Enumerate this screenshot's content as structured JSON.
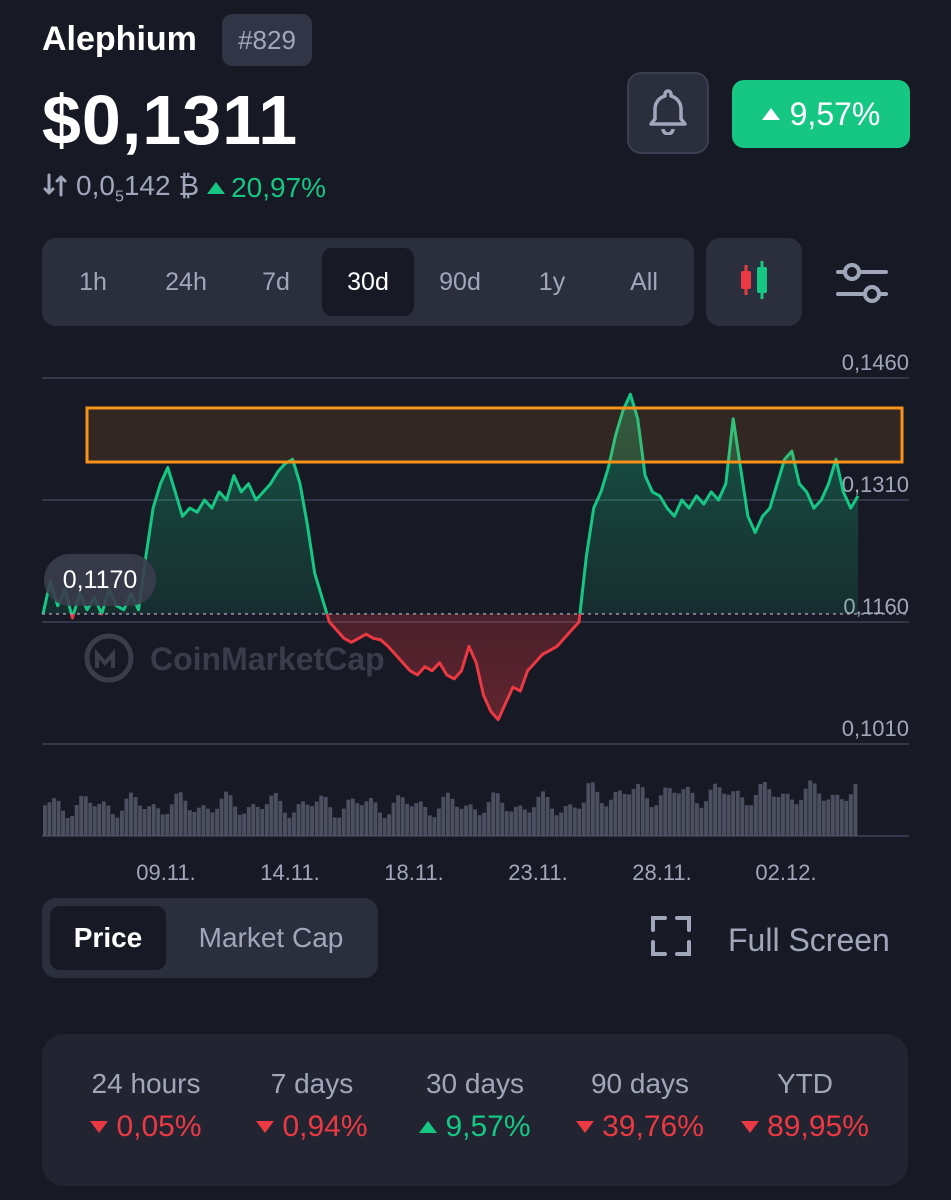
{
  "coin": {
    "name": "Alephium",
    "rank": "#829",
    "price": "$0,1311"
  },
  "btc": {
    "value_prefix": "0,0",
    "value_sub": "5",
    "value_rest": "142",
    "symbol": "₿",
    "change": "20,97%"
  },
  "change_24h": "9,57%",
  "timeframes": [
    {
      "label": "1h"
    },
    {
      "label": "24h"
    },
    {
      "label": "7d"
    },
    {
      "label": "30d",
      "active": true
    },
    {
      "label": "90d"
    },
    {
      "label": "1y"
    },
    {
      "label": "All"
    }
  ],
  "chart_data": {
    "type": "line",
    "y_ticks": [
      "0,1460",
      "0,1310",
      "0,1160",
      "0,1010"
    ],
    "x_ticks": [
      "09.11.",
      "14.11.",
      "18.11.",
      "23.11.",
      "28.11.",
      "02.12."
    ],
    "baseline_label": "0,1170",
    "baseline": 0.117,
    "ylim": [
      0.101,
      0.146
    ],
    "watermark": "CoinMarketCap",
    "series": [
      {
        "values": [
          0.117,
          0.121,
          0.118,
          0.12,
          0.1165,
          0.1195,
          0.1175,
          0.119,
          0.117,
          0.12,
          0.118,
          0.1175,
          0.1195,
          0.1175,
          0.124,
          0.13,
          0.133,
          0.135,
          0.132,
          0.129,
          0.13,
          0.1295,
          0.131,
          0.13,
          0.132,
          0.131,
          0.134,
          0.132,
          0.133,
          0.131,
          0.132,
          0.133,
          0.1345,
          0.1355,
          0.136,
          0.133,
          0.128,
          0.122,
          0.119,
          0.116,
          0.115,
          0.114,
          0.1135,
          0.114,
          0.1145,
          0.114,
          0.1138,
          0.113,
          0.112,
          0.111,
          0.11,
          0.1095,
          0.1105,
          0.11,
          0.111,
          0.1095,
          0.109,
          0.11,
          0.113,
          0.111,
          0.107,
          0.105,
          0.104,
          0.106,
          0.108,
          0.1075,
          0.11,
          0.111,
          0.112,
          0.1125,
          0.113,
          0.114,
          0.115,
          0.116,
          0.124,
          0.13,
          0.132,
          0.135,
          0.139,
          0.142,
          0.144,
          0.141,
          0.134,
          0.132,
          0.1315,
          0.13,
          0.129,
          0.131,
          0.13,
          0.1315,
          0.1305,
          0.132,
          0.131,
          0.133,
          0.141,
          0.135,
          0.129,
          0.127,
          0.129,
          0.13,
          0.133,
          0.136,
          0.137,
          0.133,
          0.132,
          0.13,
          0.131,
          0.133,
          0.136,
          0.132,
          0.13,
          0.1315
        ]
      }
    ]
  },
  "view_toggle": {
    "price": "Price",
    "market_cap": "Market Cap"
  },
  "fullscreen_label": "Full Screen",
  "stats": [
    {
      "label": "24 hours",
      "value": "0,05%",
      "dir": "down"
    },
    {
      "label": "7 days",
      "value": "0,94%",
      "dir": "down"
    },
    {
      "label": "30 days",
      "value": "9,57%",
      "dir": "up"
    },
    {
      "label": "90 days",
      "value": "39,76%",
      "dir": "down"
    },
    {
      "label": "YTD",
      "value": "89,95%",
      "dir": "down"
    }
  ],
  "colors": {
    "up": "#16c784",
    "down": "#ea3943",
    "bg": "#171924",
    "panel": "#2b2e3d",
    "highlight": "#f7931a"
  }
}
